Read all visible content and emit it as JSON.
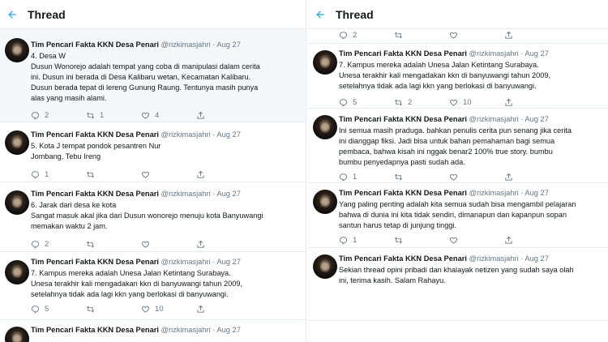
{
  "header": {
    "title": "Thread"
  },
  "left_tweets": [
    {
      "name": "Tim Pencari Fakta KKN Desa Penari",
      "handle": "@rizkimasjahri",
      "sep": "·",
      "date": "Aug 27",
      "lines": [
        "4. Desa W",
        "Dusun Wonorejo adalah tempat yang coba di manipulasi dalam cerita",
        "ini. Dusun ini berada di Desa Kalibaru wetan, Kecamatan Kalibaru.",
        "Dusun berada tepat di lereng Gunung Raung. Tentunya masih punya",
        "alas yang masih alami."
      ],
      "replies": "2",
      "retweets": "1",
      "likes": "4"
    },
    {
      "name": "Tim Pencari Fakta KKN Desa Penari",
      "handle": "@rizkimasjahri",
      "sep": "·",
      "date": "Aug 27",
      "lines": [
        "5. Kota J tempat pondok pesantren Nur",
        "Jombang, Tebu Ireng"
      ],
      "replies": "1",
      "retweets": "",
      "likes": ""
    },
    {
      "name": "Tim Pencari Fakta KKN Desa Penari",
      "handle": "@rizkimasjahri",
      "sep": "·",
      "date": "Aug 27",
      "lines": [
        "6. Jarak dari desa ke kota",
        "Sangat masuk akal jika dari Dusun wonorejo menuju kota Banyuwangi",
        "memakan waktu 2 jam."
      ],
      "replies": "2",
      "retweets": "",
      "likes": ""
    },
    {
      "name": "Tim Pencari Fakta KKN Desa Penari",
      "handle": "@rizkimasjahri",
      "sep": "·",
      "date": "Aug 27",
      "lines": [
        "7. Kampus mereka adalah Unesa Jalan Ketintang Surabaya.",
        "Unesa terakhir kali mengadakan kkn di banyuwangi tahun 2009,",
        "setelahnya tidak ada lagi kkn yang berlokasi di banyuwangi."
      ],
      "replies": "5",
      "retweets": "",
      "likes": "10"
    },
    {
      "name": "Tim Pencari Fakta KKN Desa Penari",
      "handle": "@rizkimasjahri",
      "sep": "·",
      "date": "Aug 27",
      "lines": [],
      "replies": "",
      "retweets": "",
      "likes": ""
    }
  ],
  "right_top_actions": {
    "replies": "2",
    "retweets": "",
    "likes": ""
  },
  "right_tweets": [
    {
      "name": "Tim Pencari Fakta KKN Desa Penari",
      "handle": "@rizkimasjahri",
      "sep": "·",
      "date": "Aug 27",
      "lines": [
        "7. Kampus mereka adalah Unesa Jalan Ketintang Surabaya.",
        "Unesa terakhir kali mengadakan kkn di banyuwangi tahun 2009,",
        "setelahnya tidak ada lagi kkn yang berlokasi di banyuwangi."
      ],
      "replies": "5",
      "retweets": "2",
      "likes": "10"
    },
    {
      "name": "Tim Pencari Fakta KKN Desa Penari",
      "handle": "@rizkimasjahri",
      "sep": "·",
      "date": "Aug 27",
      "lines": [
        "Ini semua masih praduga. bahkan penulis cerita pun senang jika cerita",
        "ini dianggap fiksi. Jadi bisa untuk bahan pemahaman bagi semua",
        "pembaca, bahwa kisah ini nggak benar2 100% true story. bumbu",
        "bumbu penyedapnya pasti sudah ada."
      ],
      "replies": "1",
      "retweets": "",
      "likes": ""
    },
    {
      "name": "Tim Pencari Fakta KKN Desa Penari",
      "handle": "@rizkimasjahri",
      "sep": "·",
      "date": "Aug 27",
      "lines": [
        "Yang paling penting adalah kita semua sudah bisa mengambil pelajaran",
        "bahwa di dunia ini kita tidak sendiri, dimanapun dan kapanpun sopan",
        "santun harus tetap di junjung tinggi."
      ],
      "replies": "1",
      "retweets": "",
      "likes": ""
    },
    {
      "name": "Tim Pencari Fakta KKN Desa Penari",
      "handle": "@rizkimasjahri",
      "sep": "·",
      "date": "Aug 27",
      "lines": [
        "Sekian thread opini pribadi dan khalayak netizen yang sudah saya olah",
        "ini, terima kasih. Salam Rahayu."
      ],
      "replies": "",
      "retweets": "",
      "likes": ""
    }
  ],
  "icons": {
    "back": "back-arrow-icon",
    "reply": "reply-icon",
    "retweet": "retweet-icon",
    "like": "heart-icon",
    "share": "share-icon"
  },
  "colors": {
    "accent": "#1da1f2",
    "text": "#14171a",
    "muted": "#657786",
    "highlight": "#f5f8fa",
    "border": "#e6ecf0"
  }
}
